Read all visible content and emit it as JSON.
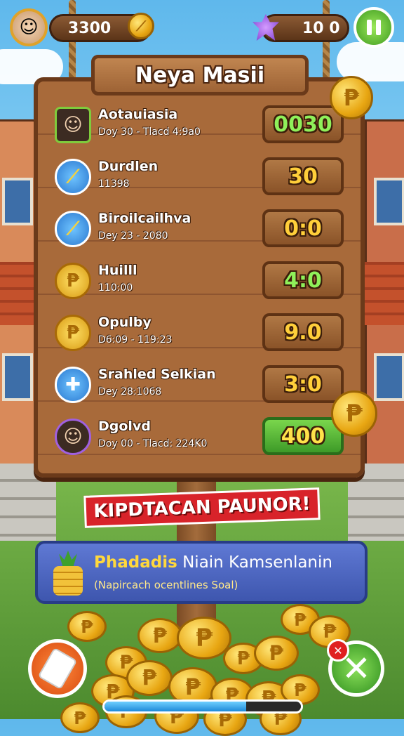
{
  "topbar": {
    "coins": "3300",
    "gems": "10 0",
    "coin_icon": "coin-icon",
    "gem_icon": "purple-gem-icon",
    "pause_icon": "pause-icon"
  },
  "board": {
    "title": "Neya Masii"
  },
  "leaderboard": [
    {
      "name": "Aotauiasia",
      "sub": "Doy 30 - Tlacd 4:9a0",
      "score": "0030",
      "score_color": "#8ff05a",
      "score_bg": "wood",
      "avatar": "portrait"
    },
    {
      "name": "Durdlen",
      "sub": "11398",
      "score": "30",
      "score_color": "#ffcf3a",
      "score_bg": "wood",
      "avatar": "banana"
    },
    {
      "name": "Biroilcailhva",
      "sub": "Dey 23 - 2080",
      "score": "0:0",
      "score_color": "#ffcf3a",
      "score_bg": "wood",
      "avatar": "banana"
    },
    {
      "name": "Huilll",
      "sub": "110:00",
      "score": "4:0",
      "score_color": "#8ff05a",
      "score_bg": "wood",
      "avatar": "gold-coin"
    },
    {
      "name": "Opulby",
      "sub": "D6:09 - 119:23",
      "score": "9.0",
      "score_color": "#ffcf3a",
      "score_bg": "wood",
      "avatar": "gold-coin"
    },
    {
      "name": "Srahled Selkian",
      "sub": "Dey 28:1068",
      "score": "3:0",
      "score_color": "#ffcf3a",
      "score_bg": "wood",
      "avatar": "blue-cross"
    },
    {
      "name": "Dgolvd",
      "sub": "Doy 00 - Tlacd: 224K0",
      "score": "400",
      "score_color": "#ffe24a",
      "score_bg": "green",
      "avatar": "portrait-purple"
    }
  ],
  "banner": {
    "text": "KIPDTACAN PAUNOR!"
  },
  "info": {
    "highlight": "Phadadis",
    "title_rest": "Niain Kamsenlanin",
    "subtitle": "(Napircach ocentlines Soal)",
    "icon": "pineapple-coins-icon"
  },
  "progress": {
    "fraction": 0.72
  },
  "bottom": {
    "left_icon": "card-icon",
    "right_icon": "close-icon"
  }
}
